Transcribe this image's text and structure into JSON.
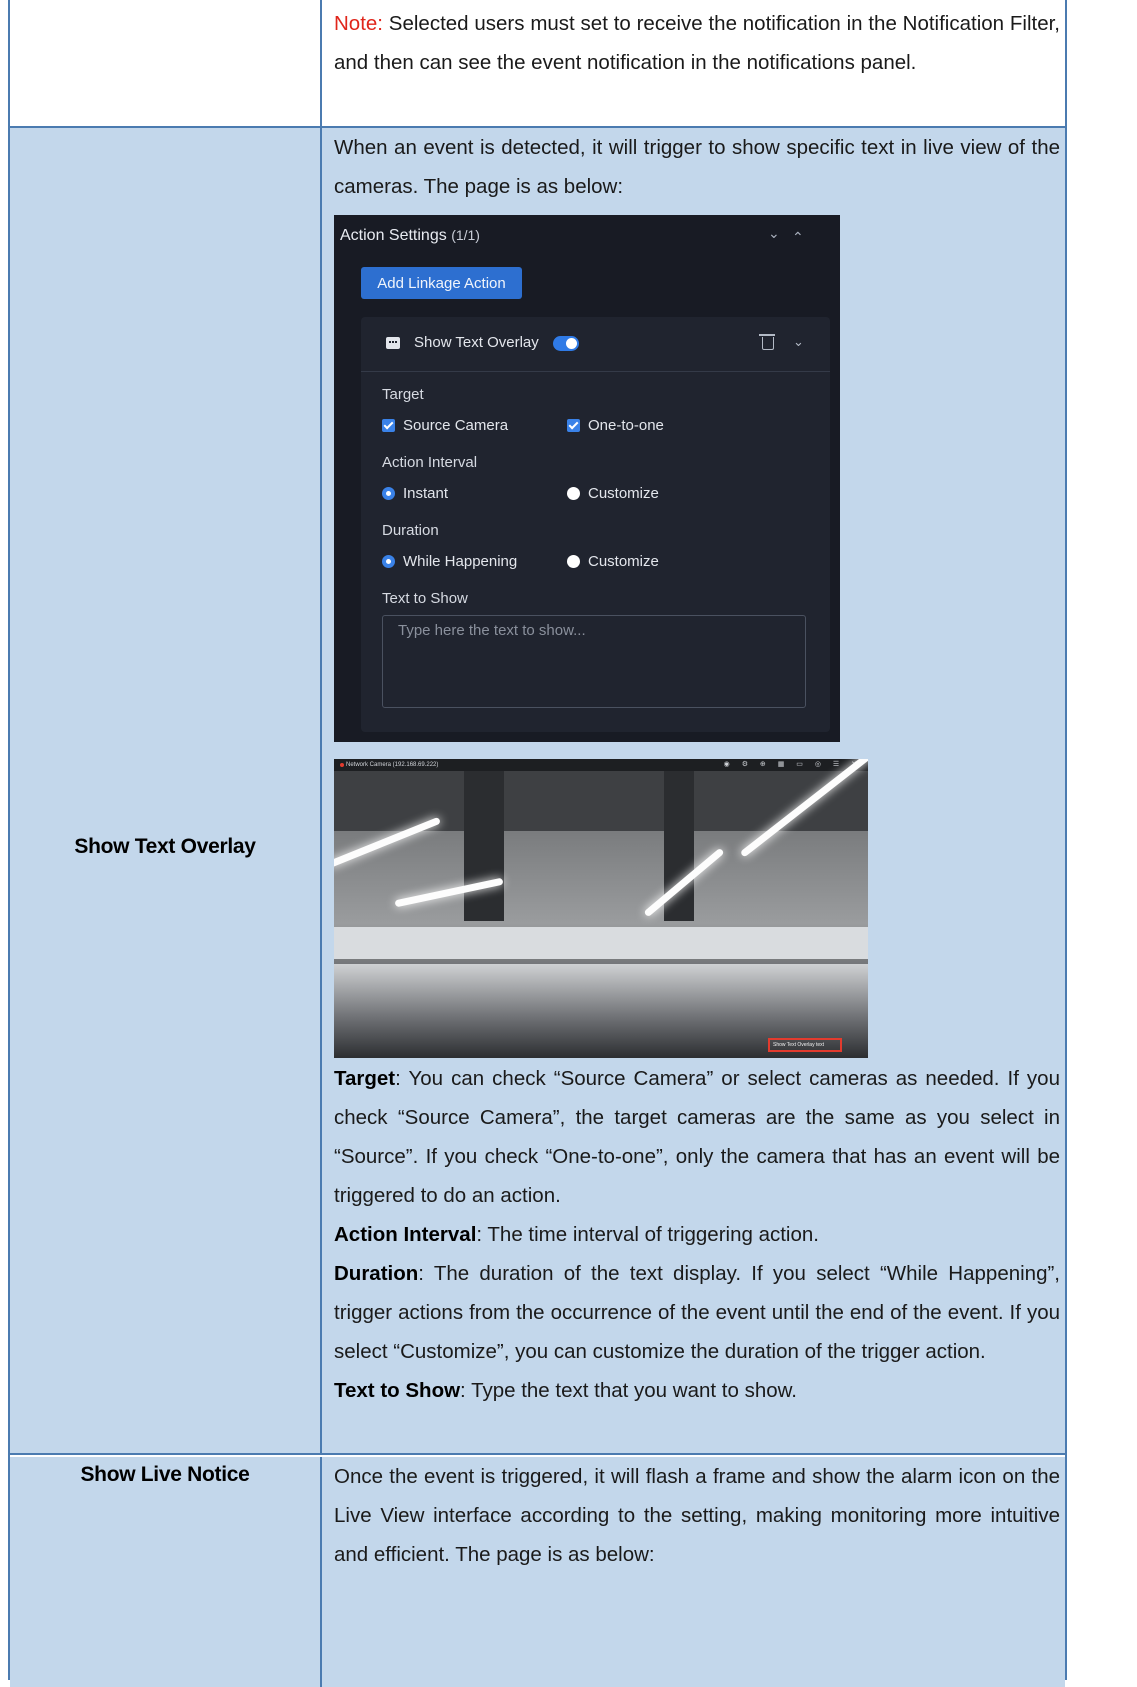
{
  "note_row": {
    "note_label": "Note:",
    "note_text": " Selected users must set to receive the notification in the Notification Filter, and then can see the event notification in the notifications panel."
  },
  "overlay_row": {
    "label": "Show Text Overlay",
    "intro": "When an event is detected, it will trigger to show specific text in live view of the cameras. The page is as below:",
    "panel": {
      "title": "Action Settings",
      "count": "(1/1)",
      "add_button": "Add Linkage Action",
      "card_title": "Show Text Overlay",
      "target_label": "Target",
      "target_options": [
        "Source Camera",
        "One-to-one"
      ],
      "interval_label": "Action Interval",
      "interval_options": [
        "Instant",
        "Customize"
      ],
      "duration_label": "Duration",
      "duration_options": [
        "While Happening",
        "Customize"
      ],
      "text_label": "Text to Show",
      "text_placeholder": "Type here the text to show..."
    },
    "camera": {
      "name": "Network Camera (192.168.69.222)",
      "icons": "◉ ⚙ ⊕ ▦ ▭ ◎ ☰ ✕",
      "overlay_text": "Show Text Overlay text"
    },
    "desc": [
      {
        "term": "Target",
        "text": ": You can check “Source Camera” or select cameras as needed. If you check “Source Camera”, the target cameras are the same as you select in “Source”. If you check “One-to-one”, only the camera that has an event will be triggered to do an action."
      },
      {
        "term": "Action Interval",
        "text": ": The time interval of triggering action."
      },
      {
        "term": "Duration",
        "text": ": The duration of the text display. If you select “While Happening”, trigger actions from the occurrence of the event until the end of the event. If you select “Customize”, you can customize the duration of the trigger action."
      },
      {
        "term": "Text to Show",
        "text": ": Type the text that you want to show."
      }
    ]
  },
  "live_row": {
    "label": "Show Live Notice",
    "text": "Once the event is triggered, it will flash a frame and show the alarm icon on the Live View interface according to the setting, making monitoring more intuitive and efficient. The page is as below:"
  }
}
